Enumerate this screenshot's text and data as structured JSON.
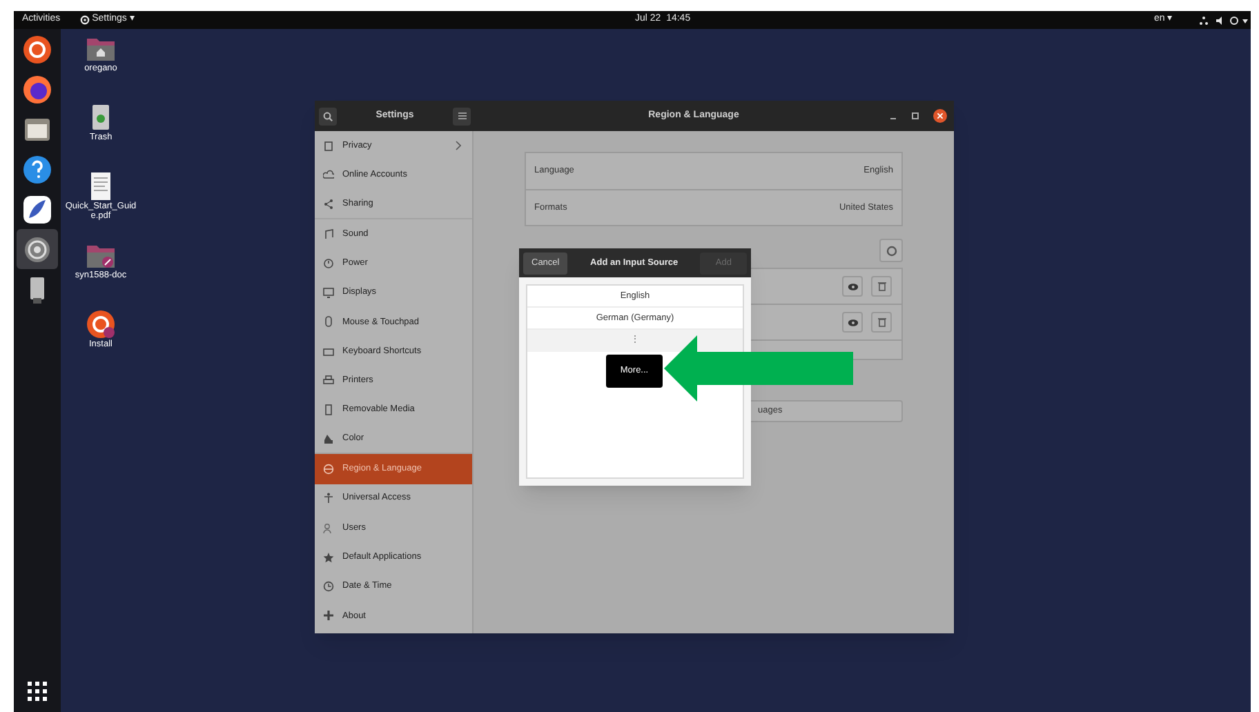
{
  "top_bar": {
    "activities": "Activities",
    "app_menu": "Settings ▾",
    "clock": "Jul 22  14:45",
    "keyboard_layout": "en ▾"
  },
  "dock": [
    {
      "kind": "ubuntu",
      "selected": false
    },
    {
      "kind": "firefox",
      "selected": false
    },
    {
      "kind": "files",
      "selected": false
    },
    {
      "kind": "help",
      "selected": false
    },
    {
      "kind": "drop",
      "selected": false
    },
    {
      "kind": "settings",
      "selected": true
    },
    {
      "kind": "usb",
      "selected": false
    }
  ],
  "desktop_icons": [
    {
      "label": "oregano",
      "kind": "home"
    },
    {
      "label": "Trash",
      "kind": "trash"
    },
    {
      "label": "Quick_Start_Guide.pdf",
      "kind": "document"
    },
    {
      "label": "syn1588-doc",
      "kind": "link-folder"
    },
    {
      "label": "Install",
      "kind": "installer"
    }
  ],
  "settings": {
    "title": "Settings",
    "page_title": "Region & Language",
    "sidebar": [
      {
        "label": "Privacy",
        "kind": "privacy",
        "selected": false,
        "submenu": true
      },
      {
        "label": "Online Accounts",
        "kind": "cloud",
        "selected": false,
        "submenu": false
      },
      {
        "label": "Sharing",
        "kind": "share",
        "selected": false,
        "submenu": false
      },
      {
        "label": "Sound",
        "kind": "note",
        "selected": false,
        "submenu": false
      },
      {
        "label": "Power",
        "kind": "power",
        "selected": false,
        "submenu": false
      },
      {
        "label": "Displays",
        "kind": "display",
        "selected": false,
        "submenu": false
      },
      {
        "label": "Mouse & Touchpad",
        "kind": "mouse",
        "selected": false,
        "submenu": false
      },
      {
        "label": "Keyboard Shortcuts",
        "kind": "keyboard",
        "selected": false,
        "submenu": false
      },
      {
        "label": "Printers",
        "kind": "printer",
        "selected": false,
        "submenu": false
      },
      {
        "label": "Removable Media",
        "kind": "media",
        "selected": false,
        "submenu": false
      },
      {
        "label": "Color",
        "kind": "color",
        "selected": false,
        "submenu": false
      },
      {
        "label": "Region & Language",
        "kind": "globe",
        "selected": true,
        "submenu": false
      },
      {
        "label": "Universal Access",
        "kind": "person",
        "selected": false,
        "submenu": false
      },
      {
        "label": "Users",
        "kind": "users",
        "selected": false,
        "submenu": false
      },
      {
        "label": "Default Applications",
        "kind": "star",
        "selected": false,
        "submenu": false
      },
      {
        "label": "Date & Time",
        "kind": "clock",
        "selected": false,
        "submenu": false
      },
      {
        "label": "About",
        "kind": "plus",
        "selected": false,
        "submenu": false
      }
    ],
    "locale_rows": [
      {
        "label": "Language",
        "value": "English"
      },
      {
        "label": "Formats",
        "value": "United States"
      }
    ],
    "manage_button": "uages"
  },
  "dialog": {
    "cancel": "Cancel",
    "title": "Add an Input Source",
    "add": "Add",
    "add_disabled": true,
    "items": [
      "English",
      "German (Germany)"
    ],
    "more_row": "⋮",
    "tooltip": "More..."
  }
}
